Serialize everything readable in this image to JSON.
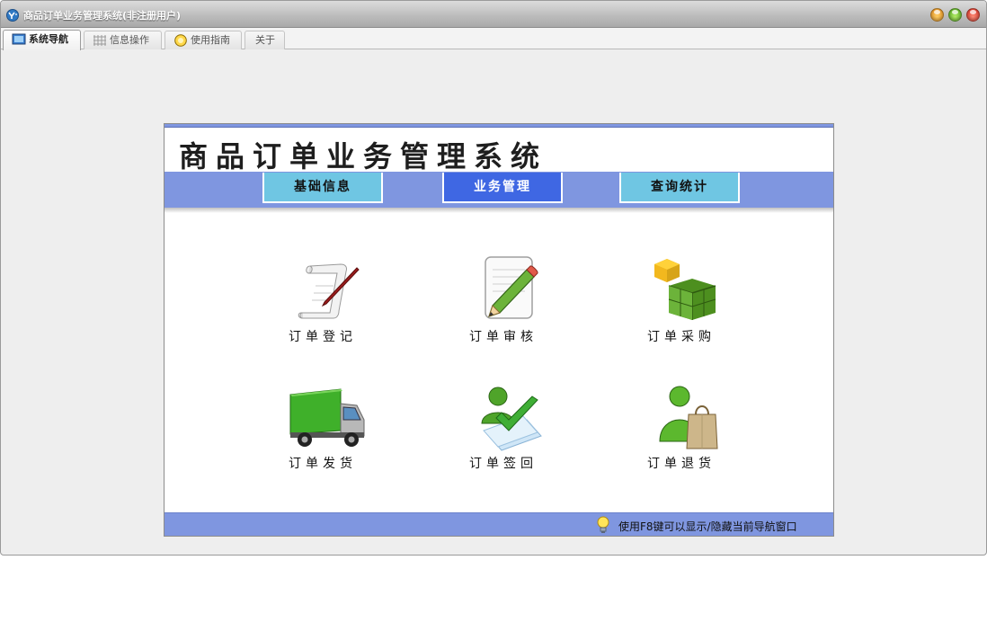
{
  "window": {
    "title": "商品订单业务管理系统(非注册用户)"
  },
  "tabs": [
    {
      "label": "系统导航",
      "active": true
    },
    {
      "label": "信息操作",
      "active": false
    },
    {
      "label": "使用指南",
      "active": false
    },
    {
      "label": "关于",
      "active": false
    }
  ],
  "panel": {
    "title": "商品订单业务管理系统",
    "nav": [
      {
        "label": "基础信息",
        "active": false
      },
      {
        "label": "业务管理",
        "active": true
      },
      {
        "label": "查询统计",
        "active": false
      }
    ],
    "items": [
      {
        "label": "订单登记",
        "icon": "scroll-quill-icon"
      },
      {
        "label": "订单审核",
        "icon": "notepad-pencil-icon"
      },
      {
        "label": "订单采购",
        "icon": "green-blocks-icon"
      },
      {
        "label": "订单发货",
        "icon": "delivery-truck-icon"
      },
      {
        "label": "订单签回",
        "icon": "user-checkmark-icon"
      },
      {
        "label": "订单退货",
        "icon": "user-shopping-bag-icon"
      }
    ],
    "footer_hint": "使用F8键可以显示/隐藏当前导航窗口"
  },
  "colors": {
    "nav_strip": "#7f96e0",
    "nav_button": "#6fc6e3",
    "nav_button_active": "#3f67e3"
  }
}
